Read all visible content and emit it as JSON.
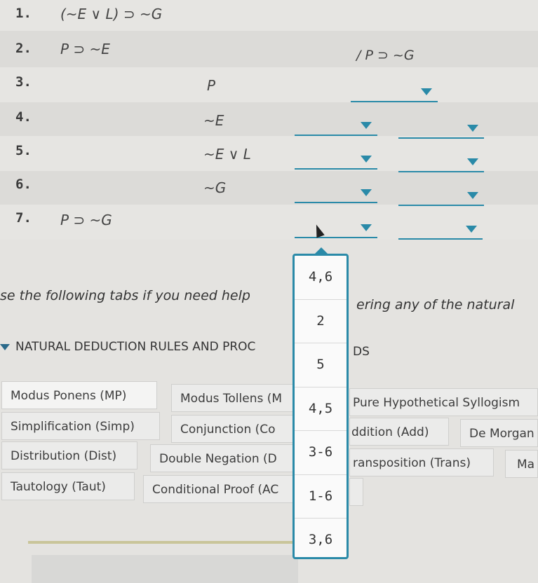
{
  "proof": {
    "lines": [
      {
        "num": "1.",
        "premise": "(~E ∨ L) ⊃ ~G",
        "formula": ""
      },
      {
        "num": "2.",
        "premise": "P ⊃ ~E",
        "formula": ""
      },
      {
        "num": "3.",
        "premise": "",
        "formula": "P"
      },
      {
        "num": "4.",
        "premise": "",
        "formula": "~E"
      },
      {
        "num": "5.",
        "premise": "",
        "formula": "~E ∨ L"
      },
      {
        "num": "6.",
        "premise": "",
        "formula": "~G"
      },
      {
        "num": "7.",
        "premise": "P ⊃ ~G",
        "formula": ""
      }
    ],
    "conclusion": "/ P ⊃ ~G"
  },
  "dropdown_options": [
    "4,6",
    "2",
    "5",
    "4,5",
    "3-6",
    "1-6",
    "3,6"
  ],
  "help_text": {
    "left": "se the following tabs if you need help",
    "right": "ering any of the natural"
  },
  "section": {
    "left": "NATURAL DEDUCTION RULES AND PROC",
    "right": "DS"
  },
  "tabs": [
    "Modus Ponens (MP)",
    "Modus Tollens (M",
    "Pure Hypothetical Syllogism",
    "Simplification (Simp)",
    "Conjunction (Co",
    "ddition (Add)",
    "De Morgan",
    "Distribution (Dist)",
    "Double Negation (D",
    "ransposition (Trans)",
    "Ma",
    "Tautology (Taut)",
    "Conditional Proof (AC"
  ],
  "colors": {
    "accent": "#2a8aa8",
    "background": "#e4e3e0"
  }
}
